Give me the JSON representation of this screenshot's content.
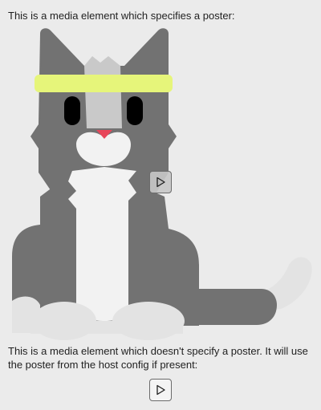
{
  "media_with_poster": {
    "caption": "This is a media element which specifies a poster:",
    "poster_icon": "cat-poster-image",
    "play_icon": "play-icon"
  },
  "media_without_poster": {
    "caption": "This is a media element which doesn't specify a poster. It will use the poster from the host config if present:",
    "play_icon": "play-icon"
  },
  "colors": {
    "background": "#ebebeb",
    "cat_body": "#727272",
    "cat_chest": "#f2f2f2",
    "headband": "#e6f57a",
    "nose": "#e8465a"
  }
}
